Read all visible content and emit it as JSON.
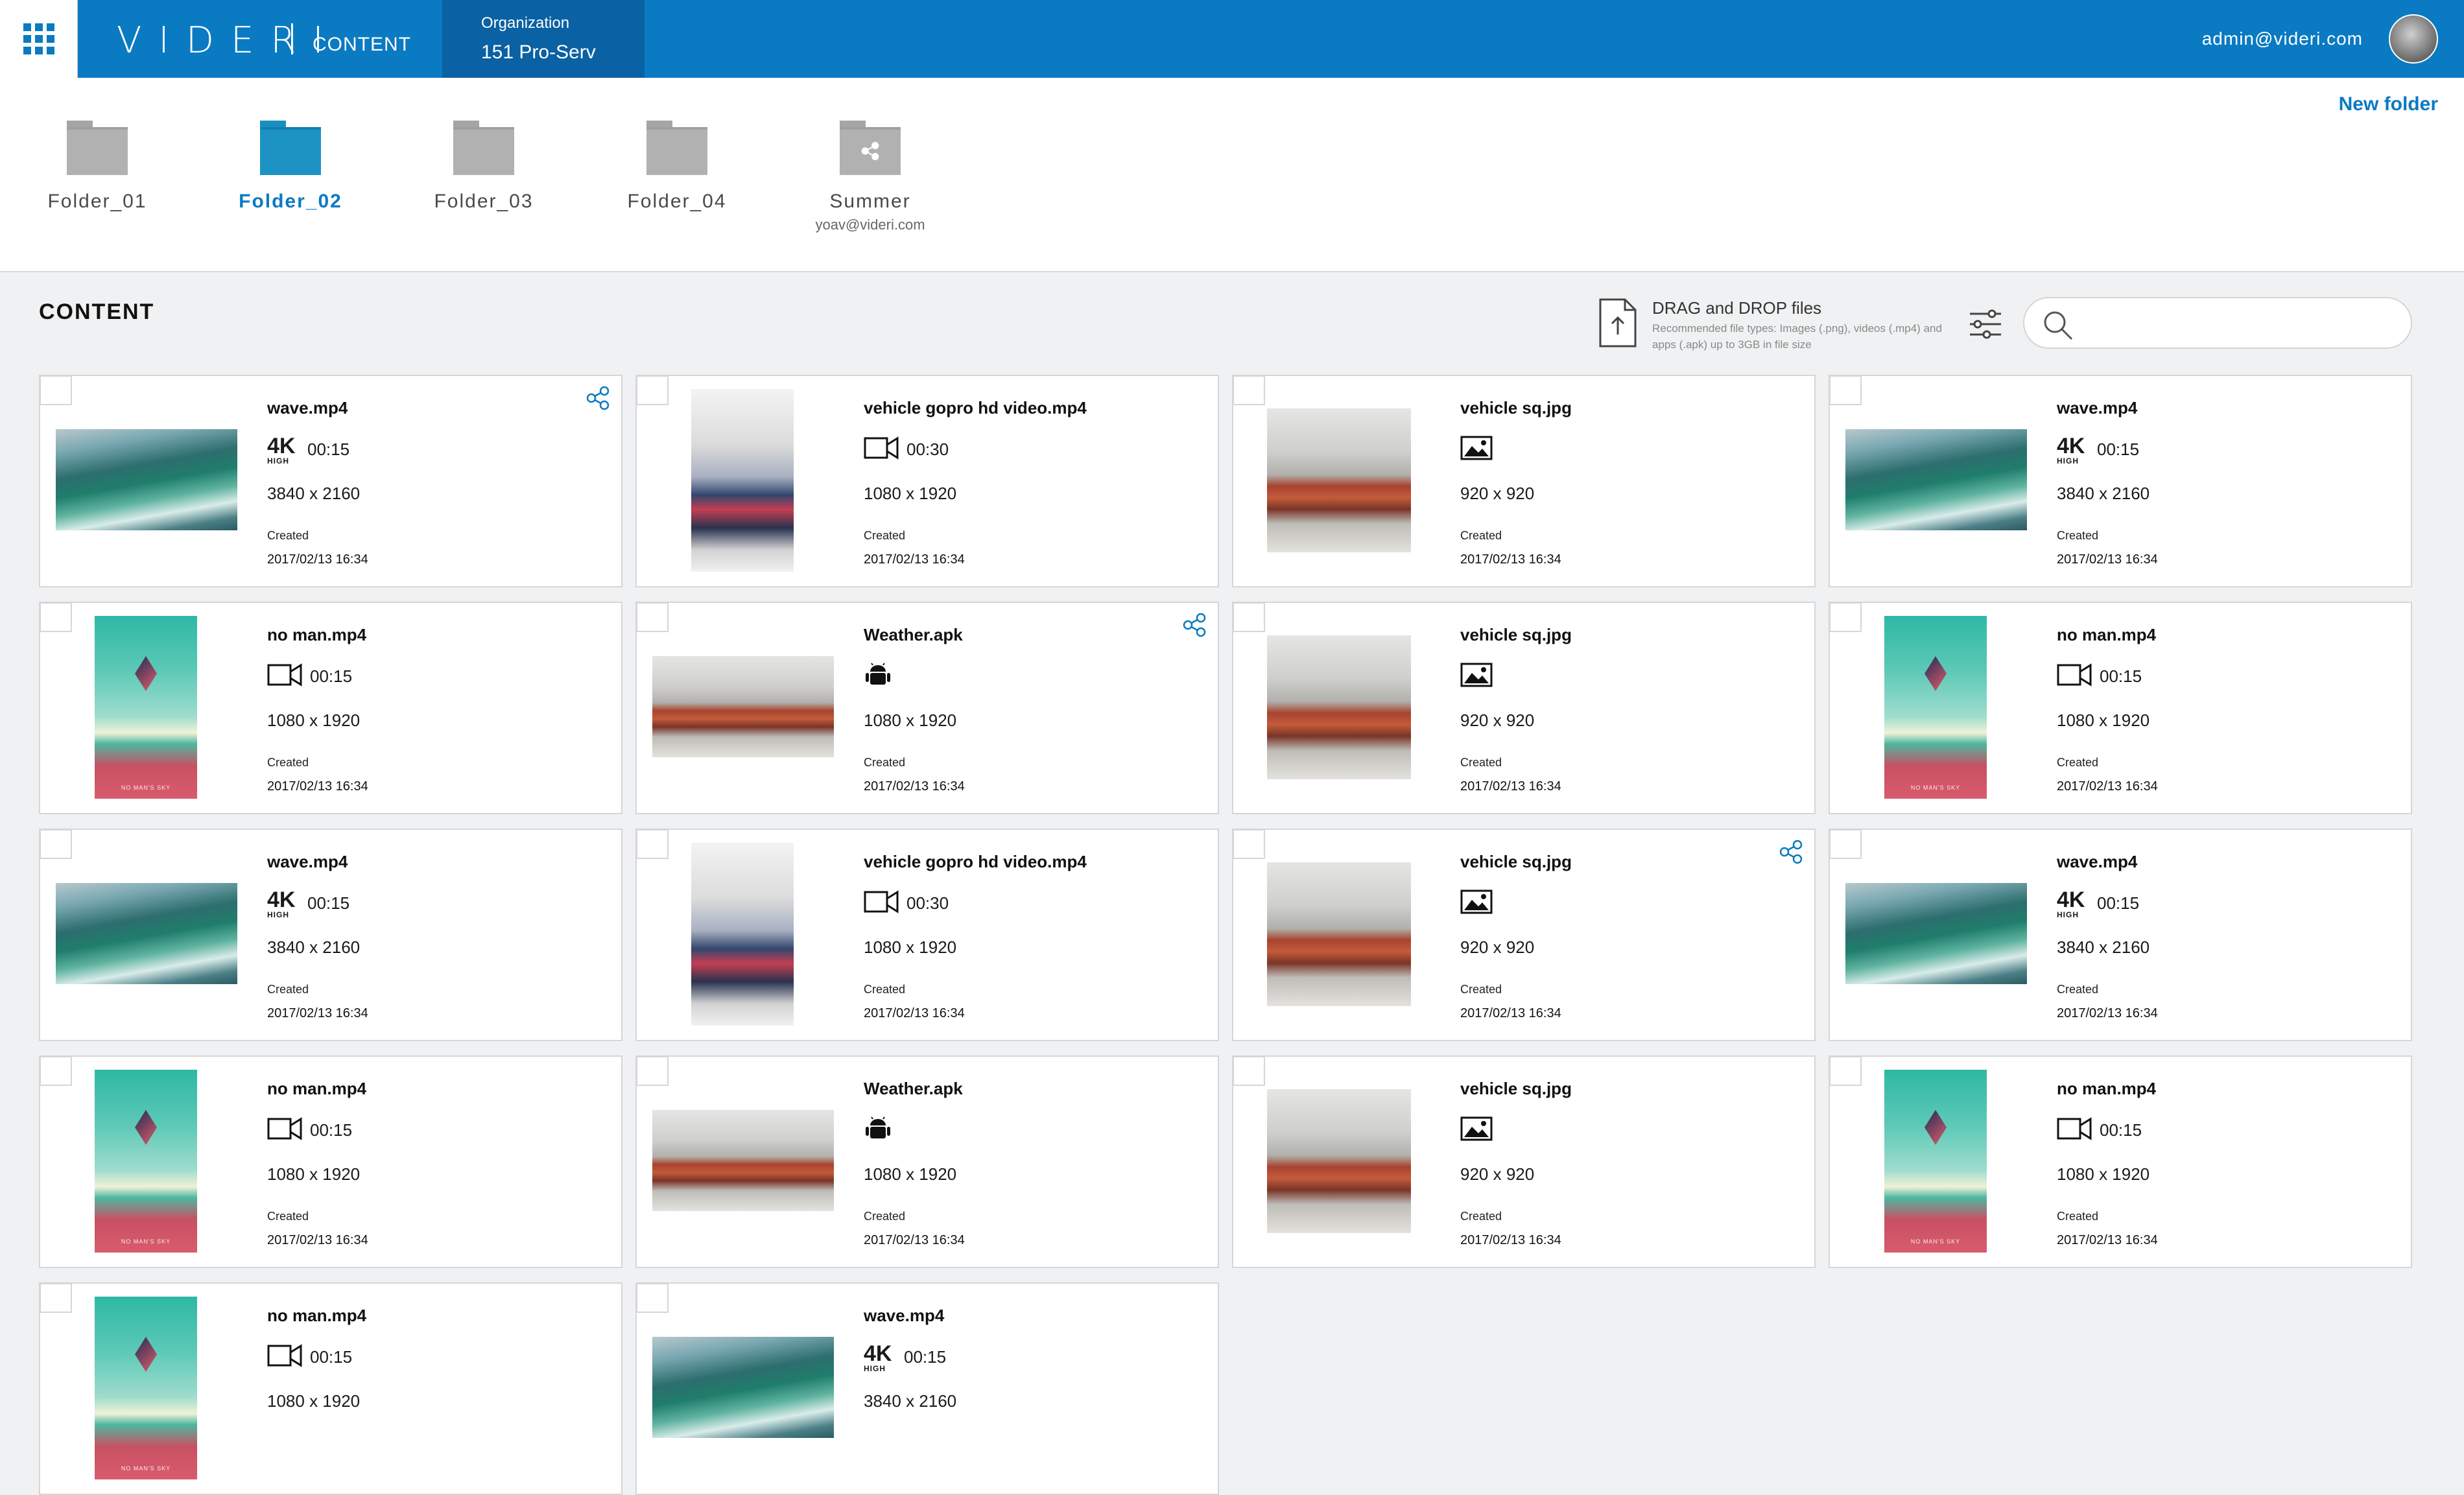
{
  "header": {
    "logo": "VIDERI",
    "section": "CONTENT",
    "org_label": "Organization",
    "org_name": "151 Pro-Serv",
    "user_email": "admin@videri.com"
  },
  "folders_bar": {
    "new_folder_label": "New folder",
    "folders": [
      {
        "label": "Folder_01",
        "sub": "",
        "active": false,
        "shared": false
      },
      {
        "label": "Folder_02",
        "sub": "",
        "active": true,
        "shared": false
      },
      {
        "label": "Folder_03",
        "sub": "",
        "active": false,
        "shared": false
      },
      {
        "label": "Folder_04",
        "sub": "",
        "active": false,
        "shared": false
      },
      {
        "label": "Summer",
        "sub": "yoav@videri.com",
        "active": false,
        "shared": true
      }
    ]
  },
  "content": {
    "title": "CONTENT",
    "upload": {
      "title": "DRAG and DROP files",
      "description": "Recommended file types: Images (.png), videos (.mp4) and apps (.apk) up to 3GB in file size"
    },
    "search": {
      "placeholder": "",
      "value": ""
    },
    "created_label": "Created",
    "items": [
      {
        "name": "wave.mp4",
        "kind": "video4k",
        "thumb": "wave",
        "fmt": "land",
        "duration": "00:15",
        "resolution": "3840 x 2160",
        "created": "2017/02/13 16:34",
        "shared": true
      },
      {
        "name": "vehicle gopro hd video.mp4",
        "kind": "video",
        "thumb": "gopro",
        "fmt": "port",
        "duration": "00:30",
        "resolution": "1080 x 1920",
        "created": "2017/02/13 16:34",
        "shared": false
      },
      {
        "name": "vehicle sq.jpg",
        "kind": "image",
        "thumb": "car",
        "fmt": "sq",
        "duration": "",
        "resolution": "920 x 920",
        "created": "2017/02/13 16:34",
        "shared": false
      },
      {
        "name": "wave.mp4",
        "kind": "video4k",
        "thumb": "wave",
        "fmt": "land",
        "duration": "00:15",
        "resolution": "3840 x 2160",
        "created": "2017/02/13 16:34",
        "shared": false
      },
      {
        "name": "no man.mp4",
        "kind": "video",
        "thumb": "nms",
        "fmt": "port",
        "duration": "00:15",
        "resolution": "1080 x 1920",
        "created": "2017/02/13 16:34",
        "shared": false
      },
      {
        "name": "Weather.apk",
        "kind": "app",
        "thumb": "car",
        "fmt": "land",
        "duration": "",
        "resolution": "1080 x 1920",
        "created": "2017/02/13 16:34",
        "shared": true
      },
      {
        "name": "vehicle sq.jpg",
        "kind": "image",
        "thumb": "car",
        "fmt": "sq",
        "duration": "",
        "resolution": "920 x 920",
        "created": "2017/02/13 16:34",
        "shared": false
      },
      {
        "name": "no man.mp4",
        "kind": "video",
        "thumb": "nms",
        "fmt": "port",
        "duration": "00:15",
        "resolution": "1080 x 1920",
        "created": "2017/02/13 16:34",
        "shared": false
      },
      {
        "name": "wave.mp4",
        "kind": "video4k",
        "thumb": "wave",
        "fmt": "land",
        "duration": "00:15",
        "resolution": "3840 x 2160",
        "created": "2017/02/13 16:34",
        "shared": false
      },
      {
        "name": "vehicle gopro hd video.mp4",
        "kind": "video",
        "thumb": "gopro",
        "fmt": "port",
        "duration": "00:30",
        "resolution": "1080 x 1920",
        "created": "2017/02/13 16:34",
        "shared": false
      },
      {
        "name": "vehicle sq.jpg",
        "kind": "image",
        "thumb": "car",
        "fmt": "sq",
        "duration": "",
        "resolution": "920 x 920",
        "created": "2017/02/13 16:34",
        "shared": true
      },
      {
        "name": "wave.mp4",
        "kind": "video4k",
        "thumb": "wave",
        "fmt": "land",
        "duration": "00:15",
        "resolution": "3840 x 2160",
        "created": "2017/02/13 16:34",
        "shared": false
      },
      {
        "name": "no man.mp4",
        "kind": "video",
        "thumb": "nms",
        "fmt": "port",
        "duration": "00:15",
        "resolution": "1080 x 1920",
        "created": "2017/02/13 16:34",
        "shared": false
      },
      {
        "name": "Weather.apk",
        "kind": "app",
        "thumb": "car",
        "fmt": "land",
        "duration": "",
        "resolution": "1080 x 1920",
        "created": "2017/02/13 16:34",
        "shared": false
      },
      {
        "name": "vehicle sq.jpg",
        "kind": "image",
        "thumb": "car",
        "fmt": "sq",
        "duration": "",
        "resolution": "920 x 920",
        "created": "2017/02/13 16:34",
        "shared": false
      },
      {
        "name": "no man.mp4",
        "kind": "video",
        "thumb": "nms",
        "fmt": "port",
        "duration": "00:15",
        "resolution": "1080 x 1920",
        "created": "2017/02/13 16:34",
        "shared": false
      },
      {
        "name": "no man.mp4",
        "kind": "video",
        "thumb": "nms",
        "fmt": "port",
        "duration": "00:15",
        "resolution": "1080 x 1920",
        "created": "",
        "shared": false
      },
      {
        "name": "wave.mp4",
        "kind": "video4k",
        "thumb": "wave",
        "fmt": "land",
        "duration": "00:15",
        "resolution": "3840 x 2160",
        "created": "",
        "shared": false
      }
    ]
  },
  "labels": {
    "k4_big": "4K",
    "k4_small": "HIGH",
    "nms_caption": "NO MAN'S SKY"
  },
  "colors": {
    "brand": "#0a7ac3",
    "org_bg": "#0a61a3",
    "active_folder": "#1d93c3"
  }
}
